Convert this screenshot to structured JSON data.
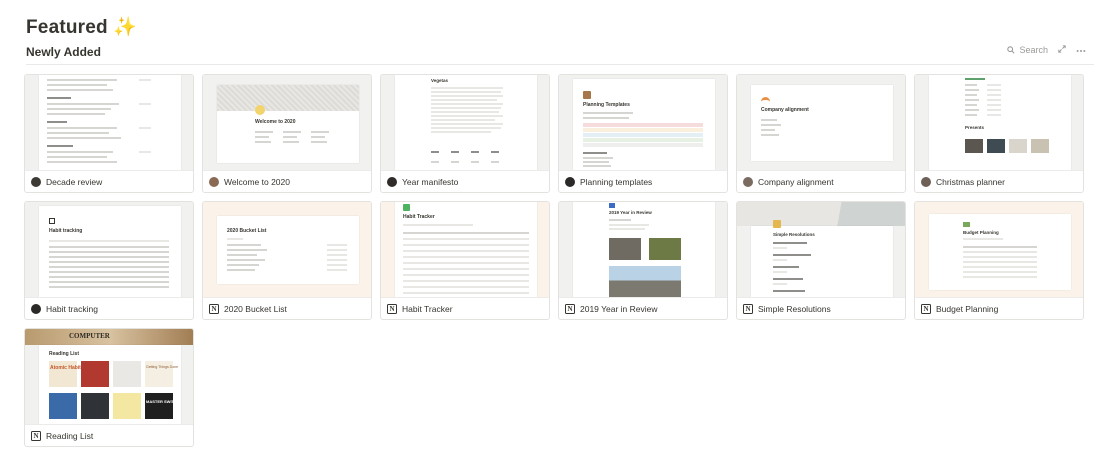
{
  "page": {
    "title": "Featured",
    "title_emoji": "✨"
  },
  "section": {
    "title": "Newly Added"
  },
  "toolbar": {
    "search_label": "Search"
  },
  "cards": [
    {
      "title": "Decade review",
      "icon": "avatar-icon"
    },
    {
      "title": "Welcome to 2020",
      "icon": "avatar-icon"
    },
    {
      "title": "Year manifesto",
      "icon": "avatar-icon"
    },
    {
      "title": "Planning templates",
      "icon": "avatar-icon"
    },
    {
      "title": "Company alignment",
      "icon": "avatar-icon"
    },
    {
      "title": "Christmas planner",
      "icon": "avatar-icon"
    },
    {
      "title": "Habit tracking",
      "icon": "avatar-icon"
    },
    {
      "title": "2020 Bucket List",
      "icon": "notion-logo-icon"
    },
    {
      "title": "Habit Tracker",
      "icon": "notion-logo-icon"
    },
    {
      "title": "2019 Year in Review",
      "icon": "notion-logo-icon"
    },
    {
      "title": "Simple Resolutions",
      "icon": "notion-logo-icon"
    },
    {
      "title": "Budget Planning",
      "icon": "notion-logo-icon"
    },
    {
      "title": "Reading List",
      "icon": "notion-logo-icon"
    }
  ],
  "previews": {
    "welcome": "Welcome to 2020",
    "manifesto": "Vegetas",
    "planning": "Planning Templates",
    "alignment": "Company alignment",
    "christmas": "Presents",
    "habit_tracking": "Habit tracking",
    "bucket": "2020 Bucket List",
    "habit_tracker": "Habit Tracker",
    "year_review": "2019 Year in Review",
    "resolutions": "Simple Resolutions",
    "budget": "Budget Planning",
    "reading": "Reading List",
    "reading_banner": "COMPUTER",
    "book_atomic": "Atomic Habits",
    "book_gtd": "Getting Things Done",
    "book_master": "MASTER SWITCH"
  }
}
